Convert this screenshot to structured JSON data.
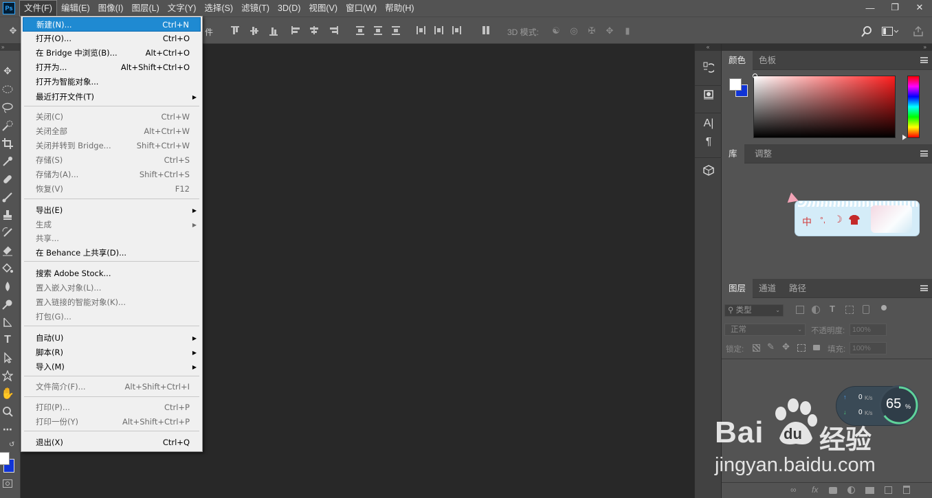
{
  "app": {
    "logo": "Ps",
    "menus": [
      "文件(F)",
      "编辑(E)",
      "图像(I)",
      "图层(L)",
      "文字(Y)",
      "选择(S)",
      "滤镜(T)",
      "3D(D)",
      "视图(V)",
      "窗口(W)",
      "帮助(H)"
    ],
    "active_menu": "文件(F)"
  },
  "options_bar": {
    "partial_text": "件",
    "mode_3d_label": "3D 模式:"
  },
  "file_menu": {
    "items": [
      {
        "label": "新建(N)...",
        "shortcut": "Ctrl+N",
        "state": "highlighted"
      },
      {
        "label": "打开(O)...",
        "shortcut": "Ctrl+O",
        "state": "enabled"
      },
      {
        "label": "在 Bridge 中浏览(B)...",
        "shortcut": "Alt+Ctrl+O",
        "state": "enabled"
      },
      {
        "label": "打开为...",
        "shortcut": "Alt+Shift+Ctrl+O",
        "state": "enabled"
      },
      {
        "label": "打开为智能对象...",
        "shortcut": "",
        "state": "enabled"
      },
      {
        "label": "最近打开文件(T)",
        "shortcut": "",
        "state": "enabled",
        "submenu": true
      },
      {
        "label": "关闭(C)",
        "shortcut": "Ctrl+W",
        "state": "disabled"
      },
      {
        "label": "关闭全部",
        "shortcut": "Alt+Ctrl+W",
        "state": "disabled"
      },
      {
        "label": "关闭并转到 Bridge...",
        "shortcut": "Shift+Ctrl+W",
        "state": "disabled"
      },
      {
        "label": "存储(S)",
        "shortcut": "Ctrl+S",
        "state": "disabled"
      },
      {
        "label": "存储为(A)...",
        "shortcut": "Shift+Ctrl+S",
        "state": "disabled"
      },
      {
        "label": "恢复(V)",
        "shortcut": "F12",
        "state": "disabled"
      },
      {
        "label": "导出(E)",
        "shortcut": "",
        "state": "enabled",
        "submenu": true
      },
      {
        "label": "生成",
        "shortcut": "",
        "state": "disabled",
        "submenu": true
      },
      {
        "label": "共享...",
        "shortcut": "",
        "state": "disabled"
      },
      {
        "label": "在 Behance 上共享(D)...",
        "shortcut": "",
        "state": "enabled"
      },
      {
        "label": "搜索 Adobe Stock...",
        "shortcut": "",
        "state": "enabled"
      },
      {
        "label": "置入嵌入对象(L)...",
        "shortcut": "",
        "state": "disabled"
      },
      {
        "label": "置入链接的智能对象(K)...",
        "shortcut": "",
        "state": "disabled"
      },
      {
        "label": "打包(G)...",
        "shortcut": "",
        "state": "disabled"
      },
      {
        "label": "自动(U)",
        "shortcut": "",
        "state": "enabled",
        "submenu": true
      },
      {
        "label": "脚本(R)",
        "shortcut": "",
        "state": "enabled",
        "submenu": true
      },
      {
        "label": "导入(M)",
        "shortcut": "",
        "state": "enabled",
        "submenu": true
      },
      {
        "label": "文件简介(F)...",
        "shortcut": "Alt+Shift+Ctrl+I",
        "state": "disabled"
      },
      {
        "label": "打印(P)...",
        "shortcut": "Ctrl+P",
        "state": "disabled"
      },
      {
        "label": "打印一份(Y)",
        "shortcut": "Alt+Shift+Ctrl+P",
        "state": "disabled"
      },
      {
        "label": "退出(X)",
        "shortcut": "Ctrl+Q",
        "state": "enabled"
      }
    ]
  },
  "panels": {
    "color_tabs": [
      "颜色",
      "色板"
    ],
    "library_tabs": [
      "库",
      "调整"
    ],
    "layers_tabs": [
      "图层",
      "通道",
      "路径"
    ],
    "layers_filter_placeholder": "类型",
    "blend_mode": "正常",
    "opacity_label": "不透明度:",
    "opacity_value": "100%",
    "lock_label": "锁定:",
    "fill_label": "填充:",
    "fill_value": "100%"
  },
  "colors": {
    "foreground": "#ffffff",
    "background": "#1034d6",
    "highlight": "#1f8ad2"
  },
  "ime_toolbar": {
    "label": "中",
    "punct": "°,",
    "moon": "☽"
  },
  "speed_widget": {
    "upload": "0",
    "download": "0",
    "unit": "K/s",
    "percent": "65",
    "percent_sign": "%"
  },
  "watermark": {
    "brand": "Bai",
    "brand2": "du",
    "product": "经验",
    "url": "jingyan.baidu.com"
  }
}
